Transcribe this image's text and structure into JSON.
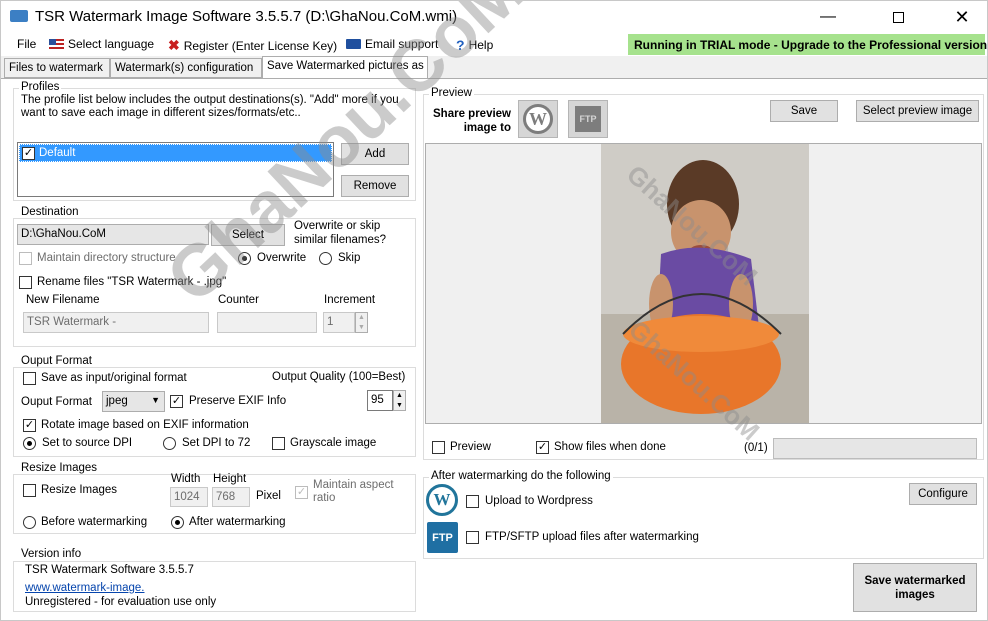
{
  "window": {
    "title": "TSR Watermark Image Software 3.5.5.7 (D:\\GhaNou.CoM.wmi)"
  },
  "menu": {
    "file": "File",
    "language": "Select language",
    "register": "Register (Enter License Key)",
    "email": "Email support",
    "help": "Help"
  },
  "trial_banner": "Running in TRIAL mode - Upgrade to the Professional version",
  "tabs": [
    "Files to watermark",
    "Watermark(s) configuration",
    "Save Watermarked pictures as"
  ],
  "profiles": {
    "title": "Profiles",
    "description": "The profile list below includes the output destinations(s). \"Add\" more if you want to save each image in different sizes/formats/etc..",
    "items": [
      "Default"
    ],
    "add": "Add",
    "remove": "Remove"
  },
  "destination": {
    "title": "Destination",
    "path": "D:\\GhaNou.CoM",
    "select": "Select",
    "overwrite_question": "Overwrite or skip similar filenames?",
    "maintain_dir": "Maintain directory structure",
    "overwrite": "Overwrite",
    "skip": "Skip",
    "rename": "Rename files \"TSR Watermark - .jpg\"",
    "new_filename_label": "New Filename",
    "counter_label": "Counter",
    "increment_label": "Increment",
    "new_filename_value": "TSR Watermark -",
    "counter_value": "",
    "increment_value": "1"
  },
  "output_format": {
    "title": "Ouput Format",
    "save_original": "Save as input/original format",
    "quality_label": "Output Quality (100=Best)",
    "format_label": "Ouput Format",
    "format_value": "jpeg",
    "preserve_exif": "Preserve EXIF Info",
    "quality_value": "95",
    "rotate": "Rotate image based on EXIF information",
    "dpi_source": "Set to source DPI",
    "dpi_72": "Set DPI to 72",
    "grayscale": "Grayscale image"
  },
  "resize": {
    "title": "Resize Images",
    "resize_label": "Resize Images",
    "width_label": "Width",
    "height_label": "Height",
    "width_value": "1024",
    "height_value": "768",
    "pixel": "Pixel",
    "maintain": "Maintain aspect ratio",
    "before": "Before watermarking",
    "after": "After watermarking"
  },
  "version": {
    "title": "Version info",
    "name": "TSR Watermark Software 3.5.5.7",
    "link": "www.watermark-image.",
    "status": "Unregistered - for evaluation use only"
  },
  "preview": {
    "title": "Preview",
    "share_label": "Share preview image to",
    "save": "Save",
    "select_image": "Select preview image",
    "preview_check": "Preview",
    "show_files": "Show files when done",
    "count": "(0/1)",
    "watermark_text": "GhaNou.CoM"
  },
  "after": {
    "title": "After watermarking do the following",
    "wordpress": "Upload to Wordpress",
    "configure": "Configure",
    "ftp": "FTP/SFTP upload files after watermarking",
    "ftp_icon_text": "FTP",
    "save_button": "Save watermarked images"
  }
}
